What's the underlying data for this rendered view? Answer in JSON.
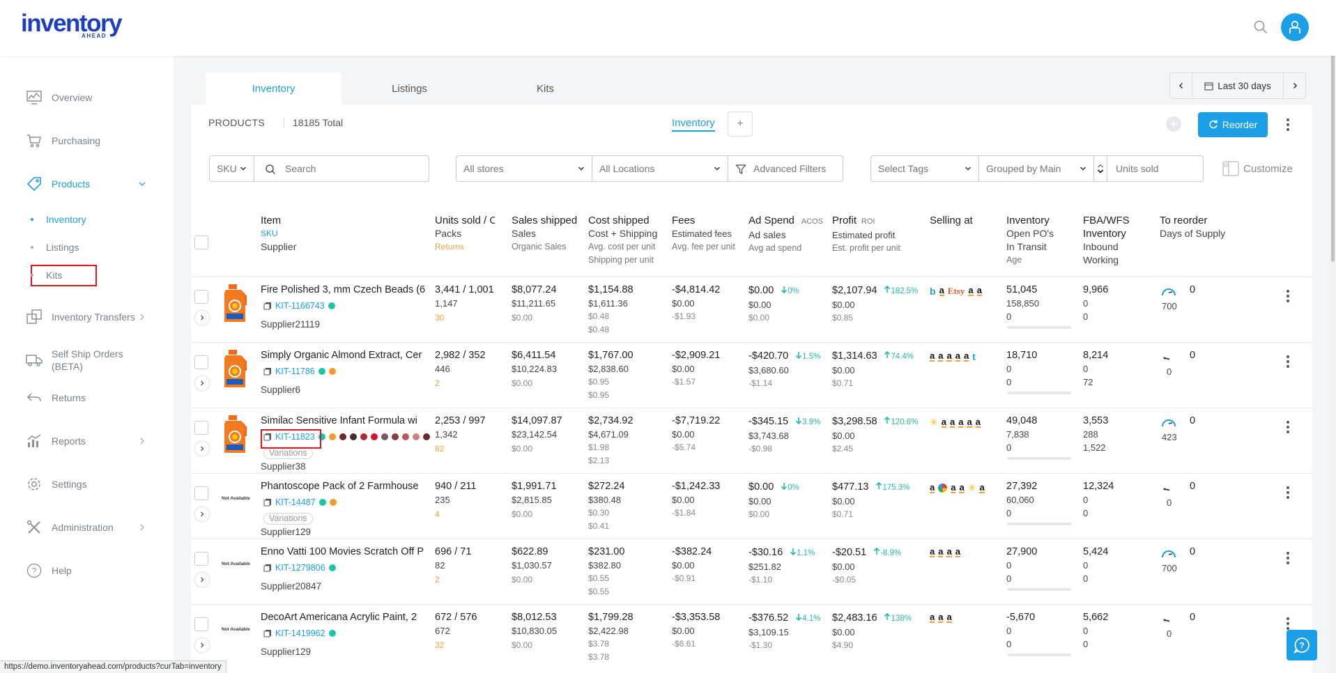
{
  "brand": {
    "name": "inventory",
    "sub": "AHEAD"
  },
  "sidebar": {
    "items": [
      {
        "label": "Overview"
      },
      {
        "label": "Purchasing"
      },
      {
        "label": "Products"
      },
      {
        "label": "Inventory Transfers"
      },
      {
        "label": "Self Ship Orders (BETA)"
      },
      {
        "label": "Returns"
      },
      {
        "label": "Reports"
      },
      {
        "label": "Settings"
      },
      {
        "label": "Administration"
      },
      {
        "label": "Help"
      }
    ],
    "products_sub": [
      {
        "label": "Inventory"
      },
      {
        "label": "Listings"
      },
      {
        "label": "Kits"
      }
    ]
  },
  "main_tabs": [
    {
      "label": "Inventory"
    },
    {
      "label": "Listings"
    },
    {
      "label": "Kits"
    }
  ],
  "date_range": {
    "label": "Last 30 days"
  },
  "products": {
    "title": "PRODUCTS",
    "total": "18185 Total",
    "view_tab": "Inventory",
    "view_add": "+",
    "reorder_label": "Reorder"
  },
  "filters": {
    "sku": "SKU",
    "search_placeholder": "Search",
    "stores": "All stores",
    "locations": "All Locations",
    "advanced": "Advanced Filters",
    "tags": "Select Tags",
    "grouped": "Grouped by Main",
    "units_placeholder": "Units sold",
    "customize": "Customize"
  },
  "headers": {
    "item": "Item",
    "sku": "SKU",
    "supplier": "Supplier",
    "units_sold": "Units sold / Orders",
    "packs": "Packs",
    "returns": "Returns",
    "sales_shipped": "Sales shipped",
    "sales": "Sales",
    "organic_sales": "Organic Sales",
    "cost_shipped": "Cost shipped",
    "cost_shipping": "Cost + Shipping",
    "avg_cost": "Avg. cost per unit",
    "ship_per_unit": "Shipping per unit",
    "fees": "Fees",
    "est_fees": "Estimated fees",
    "avg_fee": "Avg. fee per unit",
    "ad_spend": "Ad Spend",
    "acos": "ACOS",
    "ad_sales": "Ad sales",
    "avg_ad": "Avg ad spend",
    "profit": "Profit",
    "roi": "ROI",
    "est_profit": "Estimated profit",
    "est_profit_unit": "Est. profit per unit",
    "selling_at": "Selling at",
    "inventory": "Inventory",
    "open_pos": "Open PO's",
    "in_transit": "In Transit",
    "age": "Age",
    "fba": "FBA/WFS",
    "fba_inventory": "Inventory",
    "inbound": "Inbound",
    "working": "Working",
    "to_reorder": "To reorder",
    "days_supply": "Days of Supply"
  },
  "rows": [
    {
      "name": "Fire Polished 3, mm Czech Beads (6",
      "sku": "KIT-1166743",
      "dots": [
        "#1cc4a8",
        ""
      ],
      "variations": "",
      "supplier": "Supplier21119",
      "image": "detergent",
      "units": "3,441 / 1,001",
      "packs": "1,147",
      "returns": "30",
      "sales": "$8,077.24",
      "sales2": "$11,211.65",
      "organic": "$0.00",
      "cost": "$1,154.88",
      "cost2": "$1,611.36",
      "avg_cost": "$0.48",
      "ship": "$0.48",
      "fees": "-$4,814.42",
      "fees2": "$0.00",
      "fees3": "-$1.93",
      "ad": "$0.00",
      "acos": "0%",
      "acos_dir": "down",
      "ad2": "$0.00",
      "ad3": "$0.00",
      "profit": "$2,107.94",
      "roi": "182.5%",
      "profit2": "$0.00",
      "profit3": "$0.85",
      "selling": [
        "b",
        "a",
        "Etsy",
        "a",
        "a"
      ],
      "inv": "51,045",
      "inv2": "158,850",
      "inv3": "0",
      "fba": "9,966",
      "fba2": "0",
      "fba3": "0",
      "reorder": "0",
      "days": "700",
      "gauge": "high"
    },
    {
      "name": "Simply Organic Almond Extract, Cer",
      "sku": "KIT-11786",
      "dots": [
        "#1cc4a8",
        "#f79a2e"
      ],
      "variations": "",
      "supplier": "Supplier6",
      "image": "detergent",
      "units": "2,982 / 352",
      "packs": "446",
      "returns": "2",
      "sales": "$6,411.54",
      "sales2": "$10,224.83",
      "organic": "$0.00",
      "cost": "$1,767.00",
      "cost2": "$2,838.60",
      "avg_cost": "$0.95",
      "ship": "$0.95",
      "fees": "-$2,909.21",
      "fees2": "$0.00",
      "fees3": "-$1.57",
      "ad": "-$420.70",
      "acos": "1.5%",
      "acos_dir": "down",
      "ad2": "$3,680.60",
      "ad3": "-$1.14",
      "profit": "$1,314.63",
      "roi": "74.4%",
      "profit2": "$0.00",
      "profit3": "$0.71",
      "selling": [
        "a",
        "a",
        "a",
        "a",
        "a",
        "t"
      ],
      "inv": "18,710",
      "inv2": "0",
      "inv3": "0",
      "fba": "8,214",
      "fba2": "0",
      "fba3": "72",
      "reorder": "0",
      "days": "0",
      "gauge": "low"
    },
    {
      "name": "Similac Sensitive Infant Formula wi",
      "sku": "KIT-11823",
      "dots": [
        "#1cc4a8",
        "#f79a2e",
        "#6b2a2a",
        "#4a2a2a",
        "#b02a2a",
        "#d0142a",
        "#7a5a5a",
        "#8a3a3a",
        "#b85a5a",
        "#d08080",
        "#6a2a2a"
      ],
      "variations": "Variations",
      "supplier": "Supplier38",
      "image": "detergent",
      "units": "2,253 / 997",
      "packs": "1,342",
      "returns": "82",
      "sales": "$14,097.87",
      "sales2": "$23,142.54",
      "organic": "$0.00",
      "cost": "$2,734.92",
      "cost2": "$4,671.09",
      "avg_cost": "$1.98",
      "ship": "$2.13",
      "fees": "-$7,719.22",
      "fees2": "$0.00",
      "fees3": "-$5.74",
      "ad": "-$345.15",
      "acos": "3.9%",
      "acos_dir": "down",
      "ad2": "$3,743.68",
      "ad3": "-$0.98",
      "profit": "$3,298.58",
      "roi": "120.6%",
      "profit2": "$0.00",
      "profit3": "$2.45",
      "selling": [
        "w",
        "a",
        "a",
        "a",
        "a",
        "a"
      ],
      "inv": "49,048",
      "inv2": "7,838",
      "inv3": "0",
      "fba": "3,553",
      "fba2": "288",
      "fba3": "1,522",
      "reorder": "0",
      "days": "423",
      "gauge": "high"
    },
    {
      "name": "Phantoscope Pack of 2 Farmhouse",
      "sku": "KIT-14487",
      "dots": [
        "#1cc4a8",
        "#f79a2e"
      ],
      "variations": "Variations",
      "supplier": "Supplier129",
      "image": "na",
      "na_text": "Not Available",
      "units": "940 / 211",
      "packs": "235",
      "returns": "4",
      "sales": "$1,991.71",
      "sales2": "$2,815.85",
      "organic": "$0.00",
      "cost": "$272.24",
      "cost2": "$380.48",
      "avg_cost": "$0.30",
      "ship": "$0.41",
      "fees": "-$1,242.33",
      "fees2": "$0.00",
      "fees3": "-$1.84",
      "ad": "$0.00",
      "acos": "0%",
      "acos_dir": "down",
      "ad2": "$0.00",
      "ad3": "$0.00",
      "profit": "$477.13",
      "roi": "175.3%",
      "profit2": "$0.00",
      "profit3": "$0.71",
      "selling": [
        "a",
        "g",
        "a",
        "a",
        "w",
        "a"
      ],
      "inv": "27,392",
      "inv2": "60,060",
      "inv3": "0",
      "fba": "12,324",
      "fba2": "0",
      "fba3": "0",
      "reorder": "0",
      "days": "0",
      "gauge": "low"
    },
    {
      "name": "Enno Vatti 100 Movies Scratch Off P",
      "sku": "KIT-1279806",
      "dots": [
        "#1cc4a8",
        ""
      ],
      "variations": "",
      "supplier": "Supplier20847",
      "image": "na",
      "na_text": "Not Available",
      "units": "696 / 71",
      "packs": "82",
      "returns": "2",
      "sales": "$622.89",
      "sales2": "$1,030.57",
      "organic": "$0.00",
      "cost": "$231.00",
      "cost2": "$382.80",
      "avg_cost": "$0.55",
      "ship": "$0.55",
      "fees": "-$382.24",
      "fees2": "$0.00",
      "fees3": "-$0.91",
      "ad": "-$30.16",
      "acos": "1.1%",
      "acos_dir": "down",
      "ad2": "$251.82",
      "ad3": "-$1.10",
      "profit": "-$20.51",
      "roi": "-8.9%",
      "profit2": "$0.00",
      "profit3": "-$0.05",
      "selling": [
        "a",
        "a",
        "a",
        "a"
      ],
      "inv": "27,900",
      "inv2": "0",
      "inv3": "0",
      "fba": "5,424",
      "fba2": "0",
      "fba3": "0",
      "reorder": "0",
      "days": "700",
      "gauge": "high"
    },
    {
      "name": "DecoArt Americana Acrylic Paint, 2",
      "sku": "KIT-1419962",
      "dots": [
        "#1cc4a8",
        ""
      ],
      "variations": "",
      "supplier": "Supplier129",
      "image": "na",
      "na_text": "Not Available",
      "units": "672 / 576",
      "packs": "672",
      "returns": "32",
      "sales": "$8,012.53",
      "sales2": "$10,830.05",
      "organic": "$0.00",
      "cost": "$1,799.28",
      "cost2": "$2,422.98",
      "avg_cost": "$3.78",
      "ship": "$3.78",
      "fees": "-$3,353.58",
      "fees2": "$0.00",
      "fees3": "-$6.61",
      "ad": "-$376.52",
      "acos": "4.1%",
      "acos_dir": "down",
      "ad2": "$3,109.15",
      "ad3": "-$1.30",
      "profit": "$2,483.16",
      "roi": "138%",
      "profit2": "$0.00",
      "profit3": "$4.90",
      "selling": [
        "a",
        "a",
        "a"
      ],
      "inv": "-5,670",
      "inv2": "0",
      "inv3": "0",
      "fba": "5,662",
      "fba2": "0",
      "fba3": "0",
      "reorder": "0",
      "days": "0",
      "gauge": "low"
    }
  ],
  "status_url": "https://demo.inventoryahead.com/products?curTab=inventory",
  "colors": {
    "accent": "#1b9fe6",
    "brand": "#1d3fbf",
    "positive": "#26b9a3",
    "returns": "#f4a13c",
    "highlight": "#e0141e"
  }
}
